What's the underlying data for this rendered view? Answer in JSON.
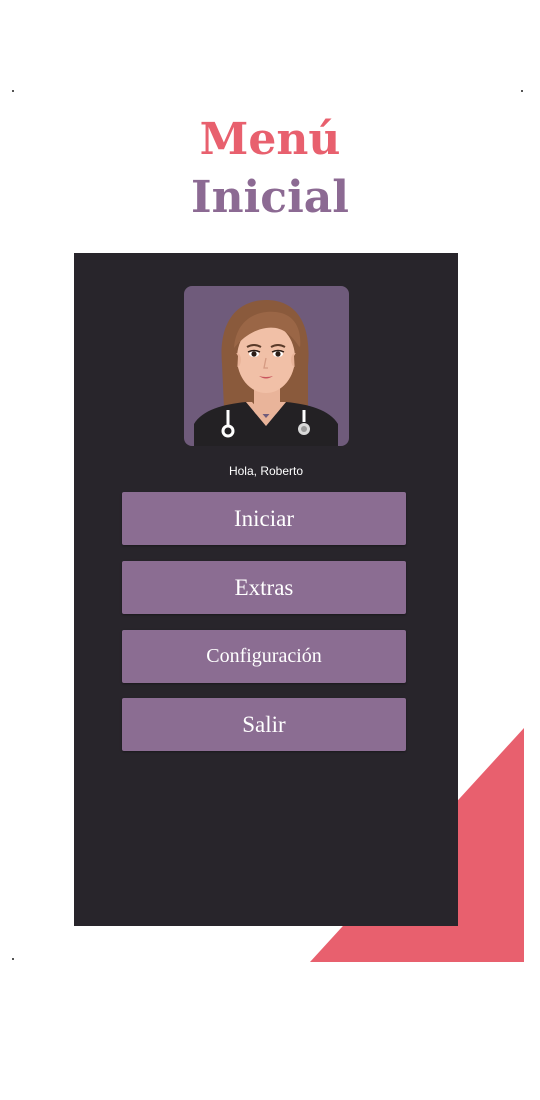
{
  "header": {
    "title_line_1": "Menú",
    "title_line_2": "Inicial"
  },
  "colors": {
    "accent_pink": "#e8606e",
    "accent_purple": "#8c6a93",
    "panel_background": "#28252b",
    "button_background": "#8b6d92",
    "avatar_background": "#6f5b7b"
  },
  "profile": {
    "avatar_icon": "female-doctor-avatar-icon",
    "greeting": "Hola, Roberto"
  },
  "menu": {
    "items": [
      {
        "label": "Iniciar"
      },
      {
        "label": "Extras"
      },
      {
        "label": "Configuración"
      },
      {
        "label": "Salir"
      }
    ]
  }
}
